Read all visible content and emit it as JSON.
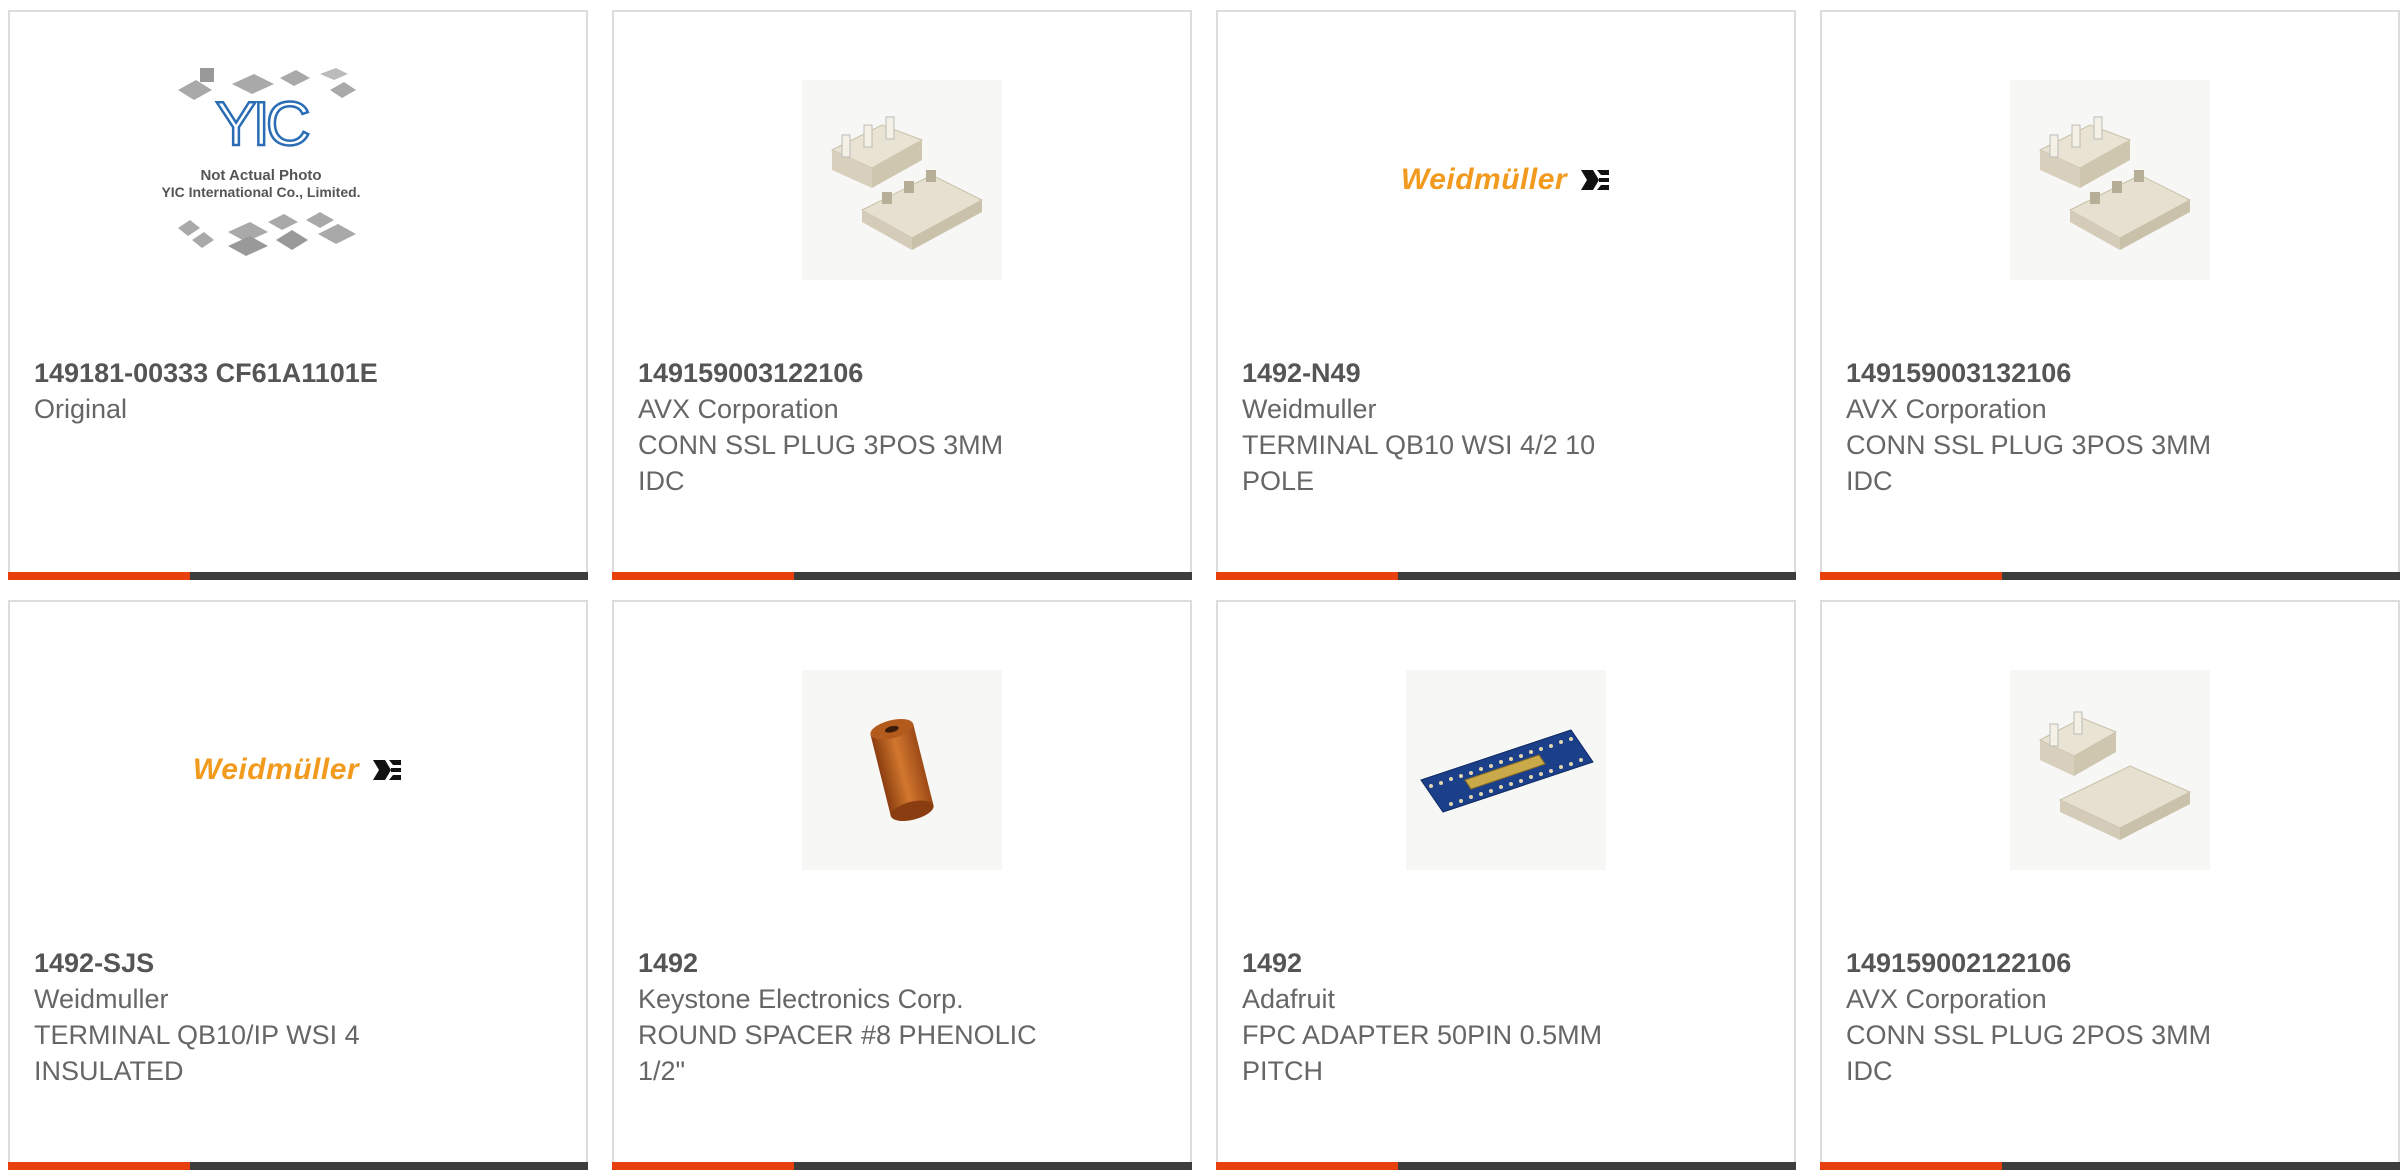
{
  "products": [
    {
      "part": "149181-00333 CF61A1101E",
      "lines": [
        "Original"
      ],
      "image": "yic-placeholder",
      "photo_caption_1": "Not Actual Photo",
      "photo_caption_2": "YIC International Co., Limited."
    },
    {
      "part": "149159003122106",
      "lines": [
        "AVX Corporation",
        "CONN SSL PLUG 3POS 3MM",
        "IDC"
      ],
      "image": "connector-3pos"
    },
    {
      "part": "1492-N49",
      "lines": [
        "Weidmuller",
        "TERMINAL QB10 WSI 4/2 10",
        "POLE"
      ],
      "image": "weidmuller-logo",
      "logo_text": "Weidmüller"
    },
    {
      "part": "149159003132106",
      "lines": [
        "AVX Corporation",
        "CONN SSL PLUG 3POS 3MM",
        "IDC"
      ],
      "image": "connector-3pos"
    },
    {
      "part": "1492-SJS",
      "lines": [
        "Weidmuller",
        "TERMINAL QB10/IP WSI 4",
        "INSULATED"
      ],
      "image": "weidmuller-logo",
      "logo_text": "Weidmüller"
    },
    {
      "part": "1492",
      "lines": [
        "Keystone Electronics Corp.",
        "ROUND SPACER #8 PHENOLIC",
        "1/2\""
      ],
      "image": "round-spacer"
    },
    {
      "part": "1492",
      "lines": [
        "Adafruit",
        "FPC ADAPTER 50PIN 0.5MM",
        "PITCH"
      ],
      "image": "fpc-adapter"
    },
    {
      "part": "149159002122106",
      "lines": [
        "AVX Corporation",
        "CONN SSL PLUG 2POS 3MM",
        "IDC"
      ],
      "image": "connector-2pos"
    }
  ],
  "colors": {
    "accent": "#e8400c",
    "bar": "#3d3d3d",
    "border": "#dcdcdc",
    "text": "#666666",
    "weidmuller_orange": "#f19a1e"
  }
}
